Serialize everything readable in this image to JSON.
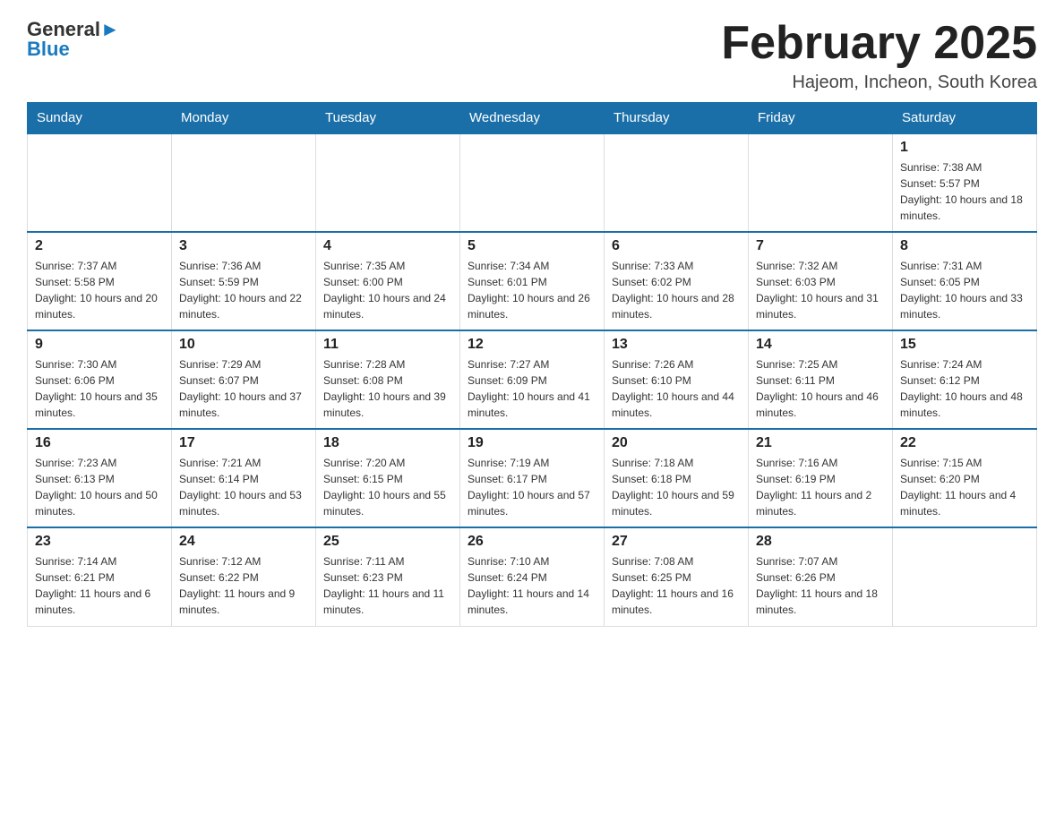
{
  "header": {
    "logo_general": "General",
    "logo_arrow": "▶",
    "logo_blue": "Blue",
    "month_title": "February 2025",
    "location": "Hajeom, Incheon, South Korea"
  },
  "weekdays": [
    "Sunday",
    "Monday",
    "Tuesday",
    "Wednesday",
    "Thursday",
    "Friday",
    "Saturday"
  ],
  "weeks": [
    [
      {
        "day": "",
        "info": ""
      },
      {
        "day": "",
        "info": ""
      },
      {
        "day": "",
        "info": ""
      },
      {
        "day": "",
        "info": ""
      },
      {
        "day": "",
        "info": ""
      },
      {
        "day": "",
        "info": ""
      },
      {
        "day": "1",
        "info": "Sunrise: 7:38 AM\nSunset: 5:57 PM\nDaylight: 10 hours and 18 minutes."
      }
    ],
    [
      {
        "day": "2",
        "info": "Sunrise: 7:37 AM\nSunset: 5:58 PM\nDaylight: 10 hours and 20 minutes."
      },
      {
        "day": "3",
        "info": "Sunrise: 7:36 AM\nSunset: 5:59 PM\nDaylight: 10 hours and 22 minutes."
      },
      {
        "day": "4",
        "info": "Sunrise: 7:35 AM\nSunset: 6:00 PM\nDaylight: 10 hours and 24 minutes."
      },
      {
        "day": "5",
        "info": "Sunrise: 7:34 AM\nSunset: 6:01 PM\nDaylight: 10 hours and 26 minutes."
      },
      {
        "day": "6",
        "info": "Sunrise: 7:33 AM\nSunset: 6:02 PM\nDaylight: 10 hours and 28 minutes."
      },
      {
        "day": "7",
        "info": "Sunrise: 7:32 AM\nSunset: 6:03 PM\nDaylight: 10 hours and 31 minutes."
      },
      {
        "day": "8",
        "info": "Sunrise: 7:31 AM\nSunset: 6:05 PM\nDaylight: 10 hours and 33 minutes."
      }
    ],
    [
      {
        "day": "9",
        "info": "Sunrise: 7:30 AM\nSunset: 6:06 PM\nDaylight: 10 hours and 35 minutes."
      },
      {
        "day": "10",
        "info": "Sunrise: 7:29 AM\nSunset: 6:07 PM\nDaylight: 10 hours and 37 minutes."
      },
      {
        "day": "11",
        "info": "Sunrise: 7:28 AM\nSunset: 6:08 PM\nDaylight: 10 hours and 39 minutes."
      },
      {
        "day": "12",
        "info": "Sunrise: 7:27 AM\nSunset: 6:09 PM\nDaylight: 10 hours and 41 minutes."
      },
      {
        "day": "13",
        "info": "Sunrise: 7:26 AM\nSunset: 6:10 PM\nDaylight: 10 hours and 44 minutes."
      },
      {
        "day": "14",
        "info": "Sunrise: 7:25 AM\nSunset: 6:11 PM\nDaylight: 10 hours and 46 minutes."
      },
      {
        "day": "15",
        "info": "Sunrise: 7:24 AM\nSunset: 6:12 PM\nDaylight: 10 hours and 48 minutes."
      }
    ],
    [
      {
        "day": "16",
        "info": "Sunrise: 7:23 AM\nSunset: 6:13 PM\nDaylight: 10 hours and 50 minutes."
      },
      {
        "day": "17",
        "info": "Sunrise: 7:21 AM\nSunset: 6:14 PM\nDaylight: 10 hours and 53 minutes."
      },
      {
        "day": "18",
        "info": "Sunrise: 7:20 AM\nSunset: 6:15 PM\nDaylight: 10 hours and 55 minutes."
      },
      {
        "day": "19",
        "info": "Sunrise: 7:19 AM\nSunset: 6:17 PM\nDaylight: 10 hours and 57 minutes."
      },
      {
        "day": "20",
        "info": "Sunrise: 7:18 AM\nSunset: 6:18 PM\nDaylight: 10 hours and 59 minutes."
      },
      {
        "day": "21",
        "info": "Sunrise: 7:16 AM\nSunset: 6:19 PM\nDaylight: 11 hours and 2 minutes."
      },
      {
        "day": "22",
        "info": "Sunrise: 7:15 AM\nSunset: 6:20 PM\nDaylight: 11 hours and 4 minutes."
      }
    ],
    [
      {
        "day": "23",
        "info": "Sunrise: 7:14 AM\nSunset: 6:21 PM\nDaylight: 11 hours and 6 minutes."
      },
      {
        "day": "24",
        "info": "Sunrise: 7:12 AM\nSunset: 6:22 PM\nDaylight: 11 hours and 9 minutes."
      },
      {
        "day": "25",
        "info": "Sunrise: 7:11 AM\nSunset: 6:23 PM\nDaylight: 11 hours and 11 minutes."
      },
      {
        "day": "26",
        "info": "Sunrise: 7:10 AM\nSunset: 6:24 PM\nDaylight: 11 hours and 14 minutes."
      },
      {
        "day": "27",
        "info": "Sunrise: 7:08 AM\nSunset: 6:25 PM\nDaylight: 11 hours and 16 minutes."
      },
      {
        "day": "28",
        "info": "Sunrise: 7:07 AM\nSunset: 6:26 PM\nDaylight: 11 hours and 18 minutes."
      },
      {
        "day": "",
        "info": ""
      }
    ]
  ]
}
